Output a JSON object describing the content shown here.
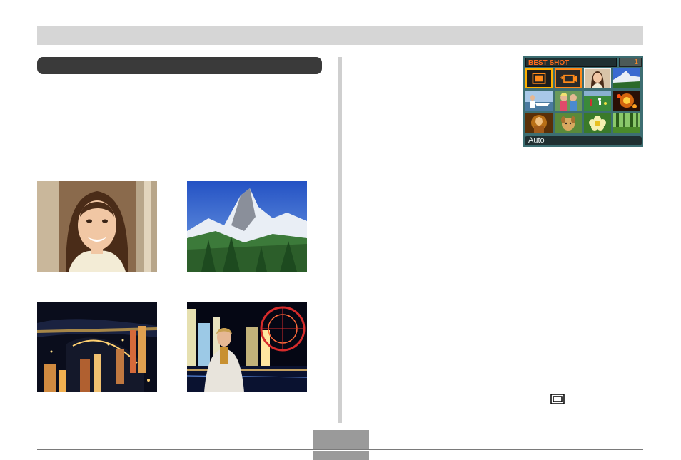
{
  "lcd": {
    "title": "BEST SHOT",
    "page": "1",
    "status": "Auto",
    "cells": [
      {
        "icon": "auto-scene-icon",
        "selected": true
      },
      {
        "icon": "movie-camera-icon",
        "selected": false
      },
      {
        "thumb": "portrait"
      },
      {
        "thumb": "mountain"
      },
      {
        "thumb": "boat-person"
      },
      {
        "thumb": "two-kids"
      },
      {
        "thumb": "sports-field"
      },
      {
        "thumb": "fireworks"
      },
      {
        "thumb": "candlelight"
      },
      {
        "thumb": "pet"
      },
      {
        "thumb": "flower"
      },
      {
        "thumb": "forest"
      }
    ]
  },
  "inline_icon": "auto-scene-icon",
  "colors": {
    "lcd_background": "#3d6e72",
    "lcd_accent": "#ff8a1a",
    "header_bar": "#d6d6d6",
    "section_pill": "#3a3a3a"
  }
}
